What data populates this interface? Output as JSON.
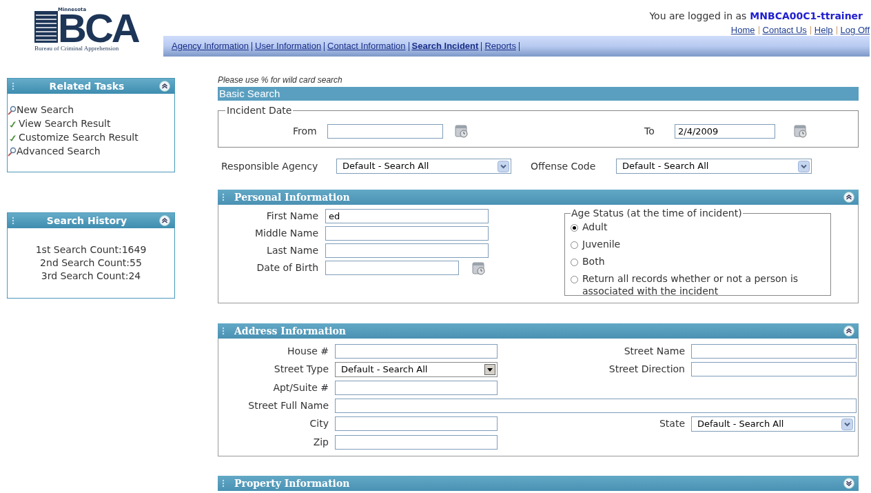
{
  "header": {
    "logo": {
      "state": "Minnesota",
      "letters": "BCA",
      "caption": "Bureau of Criminal Apprehension"
    },
    "login_text": "You are logged in as",
    "username": "MNBCA00C1-ttrainer",
    "links": [
      "Home",
      "Contact Us",
      "Help",
      "Log Off"
    ]
  },
  "nav": [
    {
      "label": "Agency Information",
      "selected": false
    },
    {
      "label": "User Information",
      "selected": false
    },
    {
      "label": "Contact Information",
      "selected": false
    },
    {
      "label": "Search Incident",
      "selected": true
    },
    {
      "label": "Reports",
      "selected": false
    }
  ],
  "sidebar": [
    {
      "title": "Related Tasks",
      "expanded": true,
      "items": [
        {
          "label": "New Search",
          "kind": "search"
        },
        {
          "label": "View Search Result",
          "kind": "check"
        },
        {
          "label": "Customize Search Result",
          "kind": "check"
        },
        {
          "label": "Advanced Search",
          "kind": "search"
        }
      ]
    },
    {
      "title": "Search History",
      "expanded": true,
      "lines": [
        "1st Search Count:1649",
        "2nd Search Count:55",
        "3rd Search Count:24"
      ]
    }
  ],
  "main": {
    "hint": "Please use % for wild card search",
    "basic_search": {
      "title": "Basic Search",
      "incident_date": {
        "legend": "Incident Date",
        "from": {
          "label": "From"
        },
        "to": {
          "label": "To",
          "value": "2/4/2009"
        }
      },
      "responsible_agency": {
        "label": "Responsible Agency",
        "value": "Default - Search All"
      },
      "offense_code": {
        "label": "Offense Code",
        "value": "Default - Search All"
      }
    },
    "personal_information": {
      "title": "Personal Information",
      "expanded": true,
      "fields": [
        {
          "label": "First Name",
          "kind": "text",
          "value": "ed"
        },
        {
          "label": "Middle Name",
          "kind": "text"
        },
        {
          "label": "Last Name",
          "kind": "text"
        },
        {
          "label": "Date of Birth",
          "kind": "date"
        }
      ],
      "age_status": {
        "legend": "Age Status (at the time of incident)",
        "options": [
          {
            "label": "Adult",
            "selected": true
          },
          {
            "label": "Juvenile",
            "selected": false
          },
          {
            "label": "Both",
            "selected": false
          },
          {
            "label": "Return all records whether or not a person is associated with the incident",
            "selected": false
          }
        ]
      }
    },
    "address_information": {
      "title": "Address Information",
      "expanded": true,
      "rows": [
        [
          {
            "label": "House #",
            "kind": "text"
          },
          {
            "label": "Street Name",
            "kind": "text"
          }
        ],
        [
          {
            "label": "Street Type",
            "kind": "select-classic",
            "value": "Default - Search All"
          },
          {
            "label": "Street Direction",
            "kind": "text"
          }
        ],
        [
          {
            "label": "Apt/Suite #",
            "kind": "text"
          }
        ],
        [
          {
            "label": "Street Full Name",
            "kind": "wide"
          }
        ],
        [
          {
            "label": "City",
            "kind": "text"
          },
          {
            "label": "State",
            "kind": "select",
            "value": "Default - Search All"
          }
        ],
        [
          {
            "label": "Zip",
            "kind": "text"
          }
        ]
      ]
    },
    "property_information": {
      "title": "Property Information",
      "expanded": false
    }
  }
}
